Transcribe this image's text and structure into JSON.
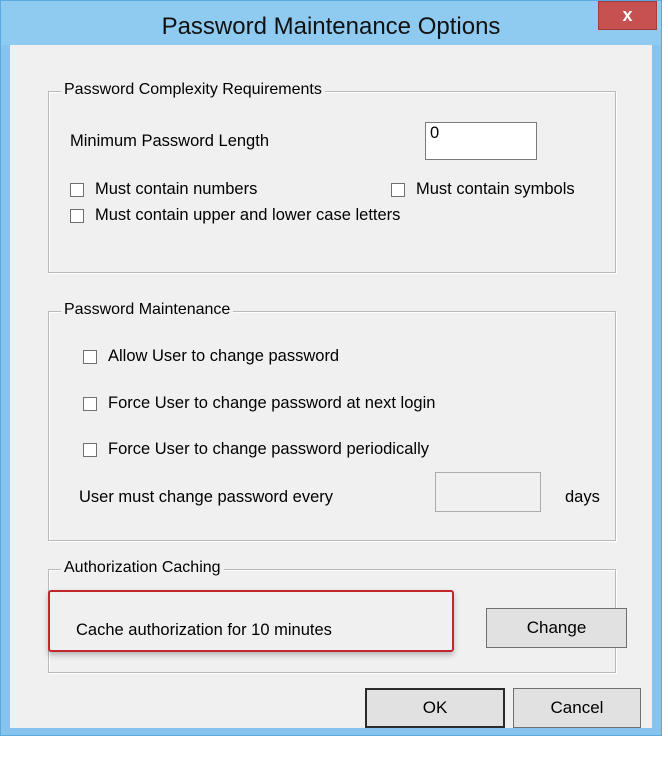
{
  "window": {
    "title": "Password Maintenance Options",
    "close_label": "x"
  },
  "complexity": {
    "legend": "Password Complexity Requirements",
    "min_length_label": "Minimum Password Length",
    "min_length_value": "0",
    "must_numbers": "Must contain numbers",
    "must_symbols": "Must contain symbols",
    "must_case": "Must contain upper and lower case letters"
  },
  "maintenance": {
    "legend": "Password Maintenance",
    "allow_change": "Allow User to change password",
    "force_next_login": "Force User to change password at next login",
    "force_periodically": "Force User to change password periodically",
    "every_label": "User must change password every",
    "every_value": "",
    "days_label": "days"
  },
  "caching": {
    "legend": "Authorization Caching",
    "cache_text": "Cache authorization for 10 minutes",
    "change_label": "Change"
  },
  "footer": {
    "ok_label": "OK",
    "cancel_label": "Cancel"
  },
  "colors": {
    "title_bar": "#8fcaf0",
    "close_button": "#c75050",
    "highlight": "#c0272d",
    "dialog_bg": "#f0f0f0"
  }
}
